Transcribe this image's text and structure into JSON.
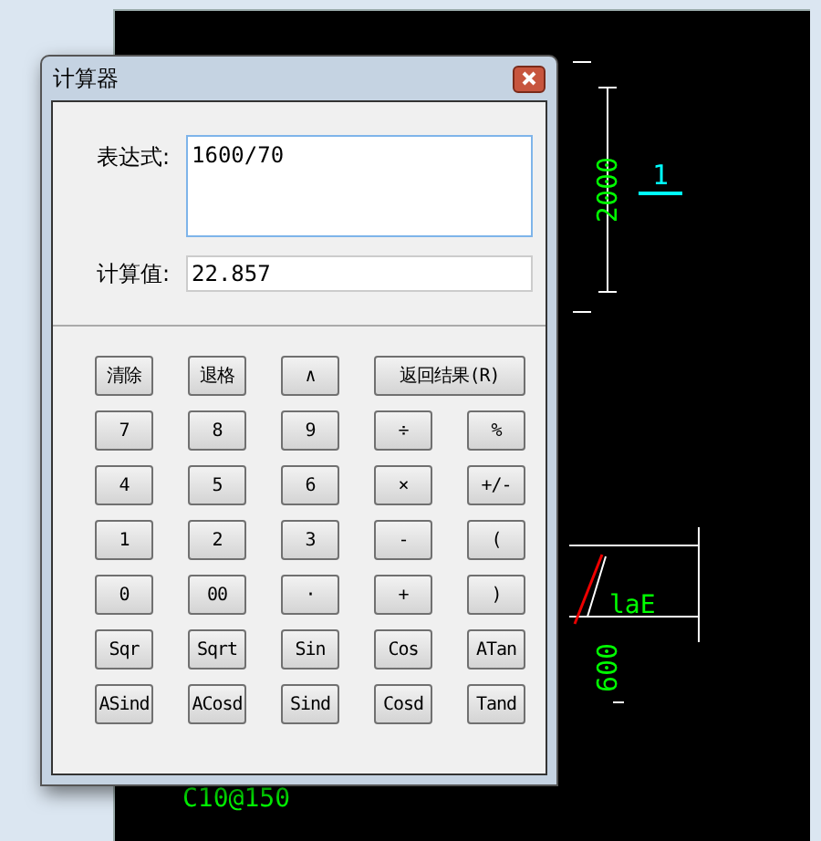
{
  "drawing": {
    "labels": [
      {
        "kind": "vertical",
        "text": "2000",
        "color": "#00ff00"
      },
      {
        "kind": "underlined",
        "text": "1",
        "color": "#00ffff"
      },
      {
        "kind": "plain",
        "text": "laE",
        "color": "#00ff00"
      },
      {
        "kind": "vertical",
        "text": "600",
        "color": "#00ff00"
      },
      {
        "kind": "plain",
        "text": "C10@150",
        "color": "#00ff00"
      }
    ]
  },
  "dialog": {
    "title": "计算器",
    "expression": {
      "label": "表达式:",
      "value": "1600/70"
    },
    "result": {
      "label": "计算值:",
      "value": "22.857"
    },
    "buttons": [
      {
        "label": "清除",
        "wide": false
      },
      {
        "label": "退格",
        "wide": false
      },
      {
        "label": "∧",
        "wide": false
      },
      {
        "label": "返回结果(R)",
        "wide": true
      },
      {
        "label": "7",
        "wide": false
      },
      {
        "label": "8",
        "wide": false
      },
      {
        "label": "9",
        "wide": false
      },
      {
        "label": "÷",
        "wide": false
      },
      {
        "label": "%",
        "wide": false
      },
      {
        "label": "4",
        "wide": false
      },
      {
        "label": "5",
        "wide": false
      },
      {
        "label": "6",
        "wide": false
      },
      {
        "label": "×",
        "wide": false
      },
      {
        "label": "+/-",
        "wide": false
      },
      {
        "label": "1",
        "wide": false
      },
      {
        "label": "2",
        "wide": false
      },
      {
        "label": "3",
        "wide": false
      },
      {
        "label": "-",
        "wide": false
      },
      {
        "label": "(",
        "wide": false
      },
      {
        "label": "0",
        "wide": false
      },
      {
        "label": "00",
        "wide": false
      },
      {
        "label": "·",
        "wide": false
      },
      {
        "label": "+",
        "wide": false
      },
      {
        "label": ")",
        "wide": false
      },
      {
        "label": "Sqr",
        "wide": false
      },
      {
        "label": "Sqrt",
        "wide": false
      },
      {
        "label": "Sin",
        "wide": false
      },
      {
        "label": "Cos",
        "wide": false
      },
      {
        "label": "ATan",
        "wide": false
      },
      {
        "label": "ASind",
        "wide": false
      },
      {
        "label": "ACosd",
        "wide": false
      },
      {
        "label": "Sind",
        "wide": false
      },
      {
        "label": "Cosd",
        "wide": false
      },
      {
        "label": "Tand",
        "wide": false
      }
    ]
  }
}
